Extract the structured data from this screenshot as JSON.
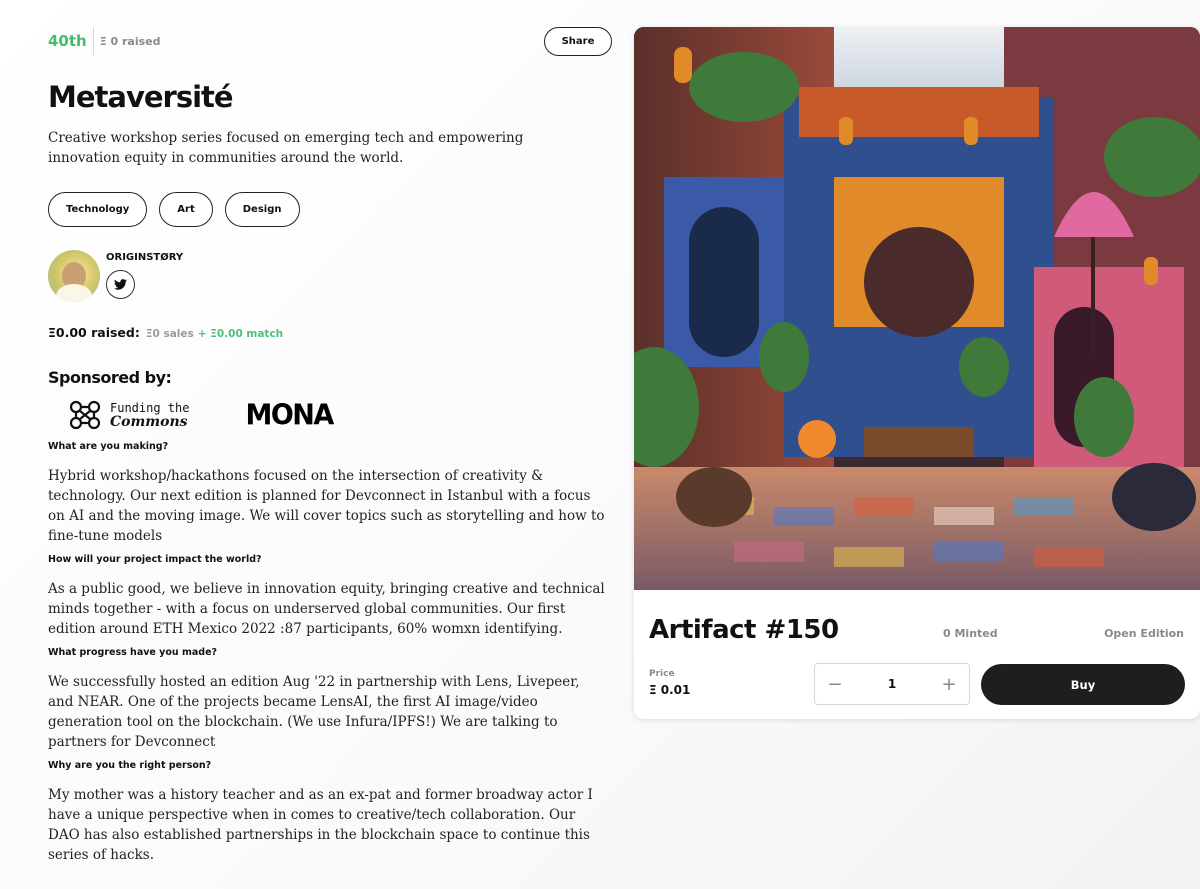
{
  "header": {
    "rank": "40th",
    "raised": "Ξ 0 raised",
    "share_label": "Share"
  },
  "project": {
    "title": "Metaversité",
    "description": "Creative workshop series focused on emerging tech and empowering innovation equity in communities around the world.",
    "tags": [
      "Technology",
      "Art",
      "Design"
    ]
  },
  "creator": {
    "name": "ORIGINSTØRY",
    "social_icon": "twitter-icon"
  },
  "funding": {
    "raised_label": "Ξ0.00 raised:",
    "sales": "Ξ0 sales",
    "match": "+ Ξ0.00 match"
  },
  "sponsors": {
    "heading": "Sponsored by:",
    "items": [
      {
        "name": "Funding the Commons",
        "line1": "Funding the",
        "line2": "Commons"
      },
      {
        "name": "MONA"
      }
    ]
  },
  "qa": [
    {
      "question": "What are you making?",
      "answer": "Hybrid workshop/hackathons focused on the intersection of creativity & technology. Our next edition is planned for Devconnect in Istanbul with a focus on AI and the moving image. We will cover topics such as storytelling and how to fine-tune models"
    },
    {
      "question": "How will your project impact the world?",
      "answer": "As a public good, we believe in innovation equity, bringing creative and technical minds together - with a focus on underserved global communities. Our first edition around ETH Mexico 2022 :87 participants, 60% womxn identifying."
    },
    {
      "question": "What progress have you made?",
      "answer": "We successfully hosted an edition Aug '22 in partnership with Lens, Livepeer, and NEAR. One of the projects became LensAI, the first AI image/video generation tool on the blockchain. (We use Infura/IPFS!) We are talking to partners for Devconnect"
    },
    {
      "question": "Why are you the right person?",
      "answer": "My mother was a history teacher and as an ex-pat and former broadway actor I have a unique perspective when in comes to creative/tech collaboration. Our DAO has also established partnerships in the blockchain space to continue this series of hacks."
    }
  ],
  "artifact": {
    "title": "Artifact #150",
    "minted": "0 Minted",
    "edition": "Open Edition",
    "price_label": "Price",
    "price_value": "Ξ 0.01",
    "quantity": "1",
    "decrement": "−",
    "increment": "+",
    "buy_label": "Buy"
  },
  "colors": {
    "accent_green": "#3fbf6a",
    "button_dark": "#1e1e1e",
    "muted_text": "#8a8a8a"
  }
}
